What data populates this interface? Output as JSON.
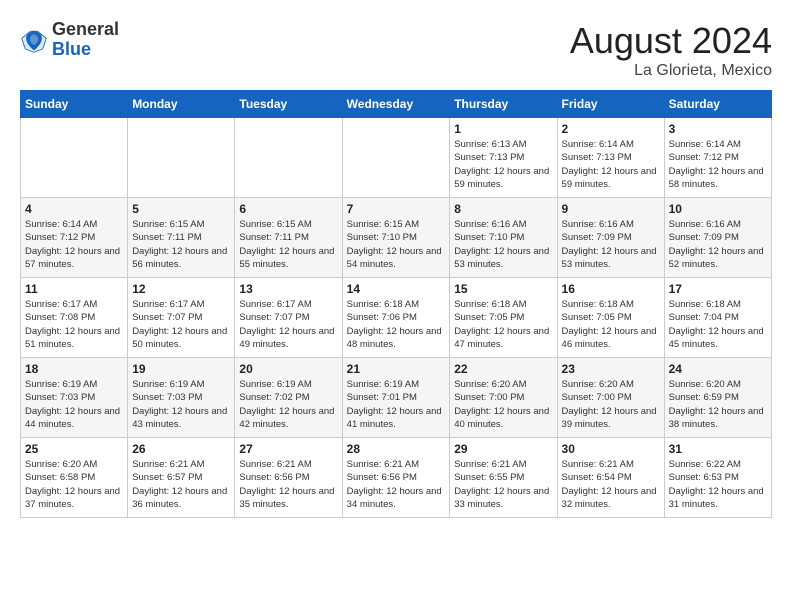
{
  "header": {
    "logo_general": "General",
    "logo_blue": "Blue",
    "month_year": "August 2024",
    "location": "La Glorieta, Mexico"
  },
  "weekdays": [
    "Sunday",
    "Monday",
    "Tuesday",
    "Wednesday",
    "Thursday",
    "Friday",
    "Saturday"
  ],
  "weeks": [
    [
      {
        "day": "",
        "sunrise": "",
        "sunset": "",
        "daylight": ""
      },
      {
        "day": "",
        "sunrise": "",
        "sunset": "",
        "daylight": ""
      },
      {
        "day": "",
        "sunrise": "",
        "sunset": "",
        "daylight": ""
      },
      {
        "day": "",
        "sunrise": "",
        "sunset": "",
        "daylight": ""
      },
      {
        "day": "1",
        "sunrise": "Sunrise: 6:13 AM",
        "sunset": "Sunset: 7:13 PM",
        "daylight": "Daylight: 12 hours and 59 minutes."
      },
      {
        "day": "2",
        "sunrise": "Sunrise: 6:14 AM",
        "sunset": "Sunset: 7:13 PM",
        "daylight": "Daylight: 12 hours and 59 minutes."
      },
      {
        "day": "3",
        "sunrise": "Sunrise: 6:14 AM",
        "sunset": "Sunset: 7:12 PM",
        "daylight": "Daylight: 12 hours and 58 minutes."
      }
    ],
    [
      {
        "day": "4",
        "sunrise": "Sunrise: 6:14 AM",
        "sunset": "Sunset: 7:12 PM",
        "daylight": "Daylight: 12 hours and 57 minutes."
      },
      {
        "day": "5",
        "sunrise": "Sunrise: 6:15 AM",
        "sunset": "Sunset: 7:11 PM",
        "daylight": "Daylight: 12 hours and 56 minutes."
      },
      {
        "day": "6",
        "sunrise": "Sunrise: 6:15 AM",
        "sunset": "Sunset: 7:11 PM",
        "daylight": "Daylight: 12 hours and 55 minutes."
      },
      {
        "day": "7",
        "sunrise": "Sunrise: 6:15 AM",
        "sunset": "Sunset: 7:10 PM",
        "daylight": "Daylight: 12 hours and 54 minutes."
      },
      {
        "day": "8",
        "sunrise": "Sunrise: 6:16 AM",
        "sunset": "Sunset: 7:10 PM",
        "daylight": "Daylight: 12 hours and 53 minutes."
      },
      {
        "day": "9",
        "sunrise": "Sunrise: 6:16 AM",
        "sunset": "Sunset: 7:09 PM",
        "daylight": "Daylight: 12 hours and 53 minutes."
      },
      {
        "day": "10",
        "sunrise": "Sunrise: 6:16 AM",
        "sunset": "Sunset: 7:09 PM",
        "daylight": "Daylight: 12 hours and 52 minutes."
      }
    ],
    [
      {
        "day": "11",
        "sunrise": "Sunrise: 6:17 AM",
        "sunset": "Sunset: 7:08 PM",
        "daylight": "Daylight: 12 hours and 51 minutes."
      },
      {
        "day": "12",
        "sunrise": "Sunrise: 6:17 AM",
        "sunset": "Sunset: 7:07 PM",
        "daylight": "Daylight: 12 hours and 50 minutes."
      },
      {
        "day": "13",
        "sunrise": "Sunrise: 6:17 AM",
        "sunset": "Sunset: 7:07 PM",
        "daylight": "Daylight: 12 hours and 49 minutes."
      },
      {
        "day": "14",
        "sunrise": "Sunrise: 6:18 AM",
        "sunset": "Sunset: 7:06 PM",
        "daylight": "Daylight: 12 hours and 48 minutes."
      },
      {
        "day": "15",
        "sunrise": "Sunrise: 6:18 AM",
        "sunset": "Sunset: 7:05 PM",
        "daylight": "Daylight: 12 hours and 47 minutes."
      },
      {
        "day": "16",
        "sunrise": "Sunrise: 6:18 AM",
        "sunset": "Sunset: 7:05 PM",
        "daylight": "Daylight: 12 hours and 46 minutes."
      },
      {
        "day": "17",
        "sunrise": "Sunrise: 6:18 AM",
        "sunset": "Sunset: 7:04 PM",
        "daylight": "Daylight: 12 hours and 45 minutes."
      }
    ],
    [
      {
        "day": "18",
        "sunrise": "Sunrise: 6:19 AM",
        "sunset": "Sunset: 7:03 PM",
        "daylight": "Daylight: 12 hours and 44 minutes."
      },
      {
        "day": "19",
        "sunrise": "Sunrise: 6:19 AM",
        "sunset": "Sunset: 7:03 PM",
        "daylight": "Daylight: 12 hours and 43 minutes."
      },
      {
        "day": "20",
        "sunrise": "Sunrise: 6:19 AM",
        "sunset": "Sunset: 7:02 PM",
        "daylight": "Daylight: 12 hours and 42 minutes."
      },
      {
        "day": "21",
        "sunrise": "Sunrise: 6:19 AM",
        "sunset": "Sunset: 7:01 PM",
        "daylight": "Daylight: 12 hours and 41 minutes."
      },
      {
        "day": "22",
        "sunrise": "Sunrise: 6:20 AM",
        "sunset": "Sunset: 7:00 PM",
        "daylight": "Daylight: 12 hours and 40 minutes."
      },
      {
        "day": "23",
        "sunrise": "Sunrise: 6:20 AM",
        "sunset": "Sunset: 7:00 PM",
        "daylight": "Daylight: 12 hours and 39 minutes."
      },
      {
        "day": "24",
        "sunrise": "Sunrise: 6:20 AM",
        "sunset": "Sunset: 6:59 PM",
        "daylight": "Daylight: 12 hours and 38 minutes."
      }
    ],
    [
      {
        "day": "25",
        "sunrise": "Sunrise: 6:20 AM",
        "sunset": "Sunset: 6:58 PM",
        "daylight": "Daylight: 12 hours and 37 minutes."
      },
      {
        "day": "26",
        "sunrise": "Sunrise: 6:21 AM",
        "sunset": "Sunset: 6:57 PM",
        "daylight": "Daylight: 12 hours and 36 minutes."
      },
      {
        "day": "27",
        "sunrise": "Sunrise: 6:21 AM",
        "sunset": "Sunset: 6:56 PM",
        "daylight": "Daylight: 12 hours and 35 minutes."
      },
      {
        "day": "28",
        "sunrise": "Sunrise: 6:21 AM",
        "sunset": "Sunset: 6:56 PM",
        "daylight": "Daylight: 12 hours and 34 minutes."
      },
      {
        "day": "29",
        "sunrise": "Sunrise: 6:21 AM",
        "sunset": "Sunset: 6:55 PM",
        "daylight": "Daylight: 12 hours and 33 minutes."
      },
      {
        "day": "30",
        "sunrise": "Sunrise: 6:21 AM",
        "sunset": "Sunset: 6:54 PM",
        "daylight": "Daylight: 12 hours and 32 minutes."
      },
      {
        "day": "31",
        "sunrise": "Sunrise: 6:22 AM",
        "sunset": "Sunset: 6:53 PM",
        "daylight": "Daylight: 12 hours and 31 minutes."
      }
    ]
  ]
}
